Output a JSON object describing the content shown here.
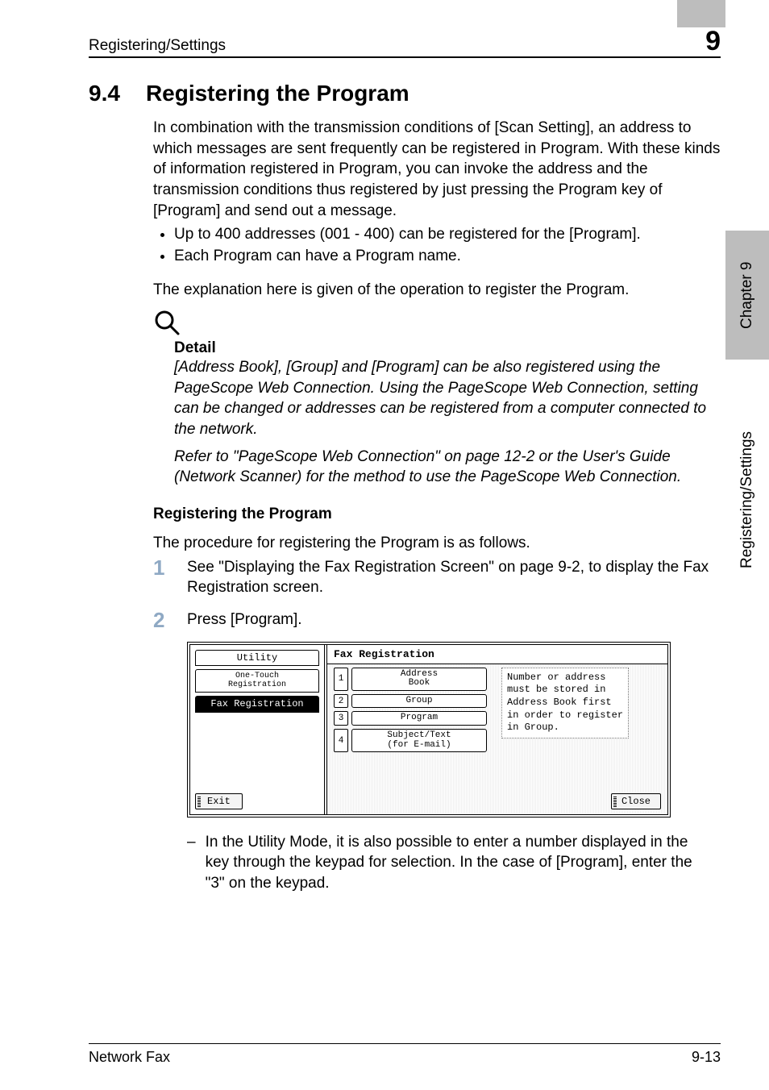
{
  "header": {
    "running_head": "Registering/Settings",
    "chapter_num": "9"
  },
  "section": {
    "num": "9.4",
    "title": "Registering the Program",
    "intro": "In combination with the transmission conditions of [Scan Setting], an address to which messages are sent frequently can be registered in Program. With these kinds of information registered in Program, you can invoke the address and the transmission conditions thus registered by just pressing the Program key of [Program] and send out a message.",
    "bullets": [
      "Up to 400 addresses (001 - 400) can be registered for the [Program].",
      "Each Program can have a Program name."
    ],
    "post_bullet": "The explanation here is given of the operation to register the Program."
  },
  "detail": {
    "heading": "Detail",
    "para1": "[Address Book], [Group] and [Program] can be also registered using the PageScope Web Connection. Using the PageScope Web Connection, setting can be changed or addresses can be registered from a computer connected to the network.",
    "para2": "Refer to \"PageScope Web Connection\" on page 12-2 or the User's Guide (Network Scanner) for the method to use the PageScope Web Connection."
  },
  "registering": {
    "heading": "Registering the Program",
    "lead": "The procedure for registering the Program is as follows.",
    "step1_num": "1",
    "step1_text": "See \"Displaying the Fax Registration Screen\" on page 9-2, to display the Fax Registration screen.",
    "step2_num": "2",
    "step2_text": "Press [Program]."
  },
  "screenshot": {
    "left": {
      "utility": "Utility",
      "one_touch": "One-Touch\nRegistration",
      "fax_reg": "Fax Registration",
      "exit": "Exit"
    },
    "right": {
      "title": "Fax Registration",
      "buttons": [
        {
          "n": "1",
          "label": "Address\nBook"
        },
        {
          "n": "2",
          "label": "Group"
        },
        {
          "n": "3",
          "label": "Program"
        },
        {
          "n": "4",
          "label": "Subject/Text\n(for E-mail)"
        }
      ],
      "info": "Number or address\nmust be stored in\nAddress Book first\nin order to register\nin Group.",
      "close": "Close"
    }
  },
  "dash_note": "In the Utility Mode, it is also possible to enter a number displayed in the key through the keypad for selection. In the case of [Program], enter the \"3\" on the keypad.",
  "side": {
    "chapter": "Chapter 9",
    "section": "Registering/Settings"
  },
  "footer": {
    "left": "Network Fax",
    "right": "9-13"
  }
}
